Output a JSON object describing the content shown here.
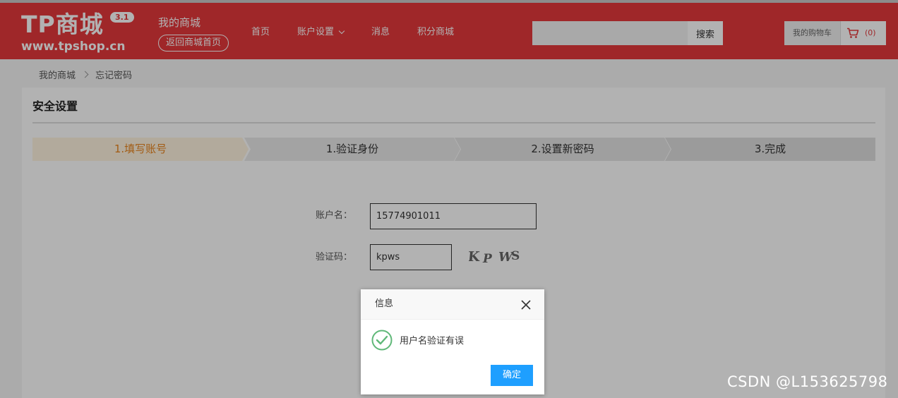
{
  "header": {
    "logo_main": "TP商城",
    "logo_version": "3.1",
    "logo_url": "www.tpshop.cn",
    "mall_title": "我的商城",
    "back_home": "返回商城首页",
    "nav": [
      {
        "label": "首页"
      },
      {
        "label": "账户设置"
      },
      {
        "label": "消息"
      },
      {
        "label": "积分商城"
      }
    ],
    "search_placeholder": "",
    "search_button": "搜索",
    "cart_label": "我的购物车",
    "cart_count": "(0)",
    "brand_color": "#e4393c"
  },
  "breadcrumb": {
    "home": "我的商城",
    "current": "忘记密码"
  },
  "panel": {
    "title": "安全设置",
    "steps": [
      {
        "label": "1.填写账号",
        "active": true
      },
      {
        "label": "1.验证身份",
        "active": false
      },
      {
        "label": "2.设置新密码",
        "active": false
      },
      {
        "label": "3.完成",
        "active": false
      }
    ],
    "account_label": "账户名：",
    "account_value": "15774901011",
    "captcha_label": "验证码：",
    "captcha_value": "kpws",
    "captcha_image_text": "KPWS"
  },
  "dialog": {
    "title": "信息",
    "message": "用户名验证有误",
    "ok_button": "确定",
    "icon": "check-circle-icon",
    "icon_color": "#5fb878",
    "button_color": "#1e9fff"
  },
  "watermark": "CSDN @L153625798"
}
